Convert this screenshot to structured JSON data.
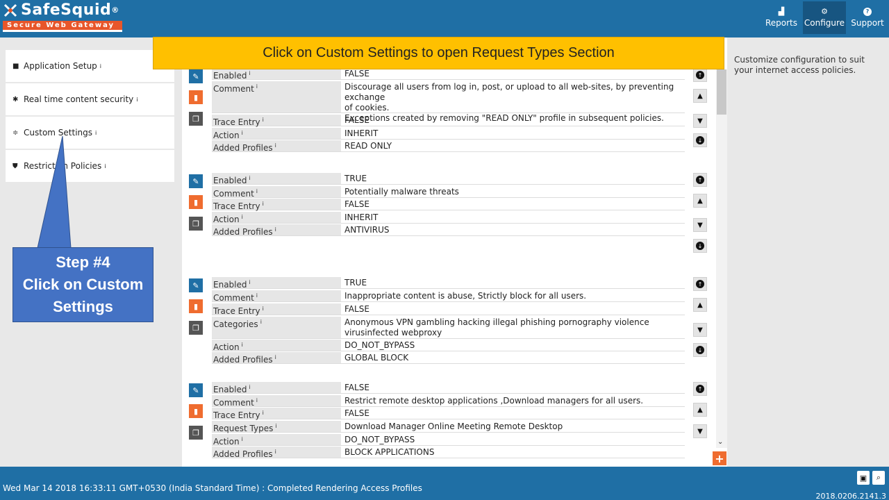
{
  "header": {
    "logo_text": "SafeSquid",
    "logo_reg": "®",
    "logo_tagline": "Secure Web Gateway",
    "nav": [
      {
        "label": "Reports",
        "icon": "chart-icon"
      },
      {
        "label": "Configure",
        "icon": "gears-icon"
      },
      {
        "label": "Support",
        "icon": "question-icon"
      }
    ]
  },
  "banner": {
    "text": "Click on Custom Settings to open Request Types Section"
  },
  "sidebar": {
    "items": [
      {
        "label": "Application Setup",
        "icon": "briefcase-icon"
      },
      {
        "label": "Real time content security",
        "icon": "bug-icon"
      },
      {
        "label": "Custom Settings",
        "icon": "sliders-icon"
      },
      {
        "label": "Restriction Policies",
        "icon": "shield-icon"
      }
    ],
    "info_mark": "i"
  },
  "info_panel": {
    "text": "Customize configuration to suit your internet access policies."
  },
  "callout": {
    "line1": "Step #4",
    "line2": "Click on Custom",
    "line3": "Settings"
  },
  "policies": [
    {
      "rows": [
        {
          "label": "Enabled",
          "value": "FALSE"
        },
        {
          "label": "Comment",
          "value": "Discourage all users from log in, post, or upload to all web-sites, by preventing exchange",
          "value2": "of cookies.",
          "value3": "Exceptions created by removing \"READ ONLY\" profile in subsequent policies."
        },
        {
          "label": "Trace Entry",
          "value": "FALSE"
        },
        {
          "label": "Action",
          "value": "INHERIT"
        },
        {
          "label": "Added Profiles",
          "value": "READ ONLY"
        }
      ]
    },
    {
      "rows": [
        {
          "label": "Enabled",
          "value": "TRUE"
        },
        {
          "label": "Comment",
          "value": "Potentially malware threats"
        },
        {
          "label": "Trace Entry",
          "value": "FALSE"
        },
        {
          "label": "Action",
          "value": "INHERIT"
        },
        {
          "label": "Added Profiles",
          "value": "ANTIVIRUS"
        }
      ]
    },
    {
      "rows": [
        {
          "label": "Enabled",
          "value": "TRUE"
        },
        {
          "label": "Comment",
          "value": "Inappropriate content is abuse, Strictly block for all users."
        },
        {
          "label": "Trace Entry",
          "value": "FALSE"
        },
        {
          "label": "Categories",
          "value": "Anonymous VPN  gambling  hacking  illegal  phishing  pornography  violence",
          "value2": "virusinfected  webproxy"
        },
        {
          "label": "Action",
          "value": "DO_NOT_BYPASS"
        },
        {
          "label": "Added Profiles",
          "value": "GLOBAL BLOCK"
        }
      ]
    },
    {
      "rows": [
        {
          "label": "Enabled",
          "value": "FALSE"
        },
        {
          "label": "Comment",
          "value": "Restrict remote desktop applications ,Download managers for all users."
        },
        {
          "label": "Trace Entry",
          "value": "FALSE"
        },
        {
          "label": "Request Types",
          "value": "Download Manager  Online Meeting  Remote Desktop"
        },
        {
          "label": "Action",
          "value": "DO_NOT_BYPASS"
        },
        {
          "label": "Added Profiles",
          "value": "BLOCK APPLICATIONS"
        }
      ]
    }
  ],
  "footer": {
    "status": "Wed Mar 14 2018 16:33:11 GMT+0530 (India Standard Time) : Completed Rendering Access Profiles",
    "version": "2018.0206.2141.3",
    "icons": [
      "save-icon",
      "search-icon"
    ]
  },
  "colors": {
    "header": "#1f6fa5",
    "banner": "#ffc000",
    "callout": "#4472c4",
    "delete": "#ef6c2f"
  }
}
